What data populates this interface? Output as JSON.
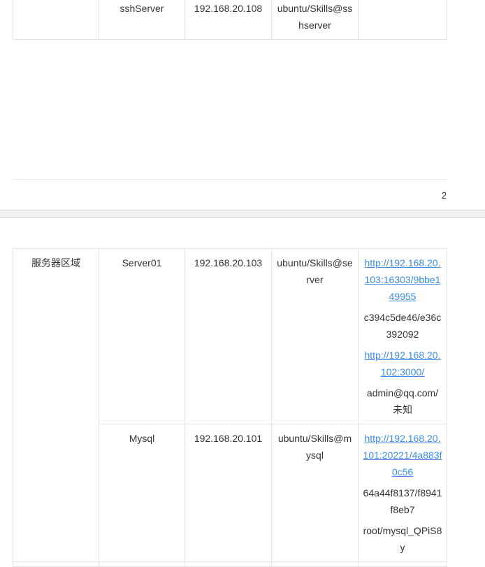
{
  "page1": {
    "rows": [
      {
        "name": "sshServer",
        "ip": "192.168.20.108",
        "account": "ubuntu/Skills@sshserver",
        "notes": []
      }
    ],
    "page_number": "2"
  },
  "page2": {
    "region": "服务器区域",
    "rows": [
      {
        "name": "Server01",
        "ip": "192.168.20.103",
        "account": "ubuntu/Skills@server",
        "notes": [
          {
            "text": "http://192.168.20.103:16303/9bbe149955",
            "link": true
          },
          {
            "text": "c394c5de46/e36c392092",
            "link": false
          },
          {
            "text": "http://192.168.20.102:3000/",
            "link": true
          },
          {
            "text": "admin@qq.com/未知",
            "link": false
          }
        ]
      },
      {
        "name": "Mysql",
        "ip": "192.168.20.101",
        "account": "ubuntu/Skills@mysql",
        "notes": [
          {
            "text": "http://192.168.20.101:20221/4a883f0c56",
            "link": true
          },
          {
            "text": "64a44f8137/f8941f8eb7",
            "link": false
          },
          {
            "text": "root/mysql_QPiS8y",
            "link": false
          }
        ]
      }
    ]
  }
}
